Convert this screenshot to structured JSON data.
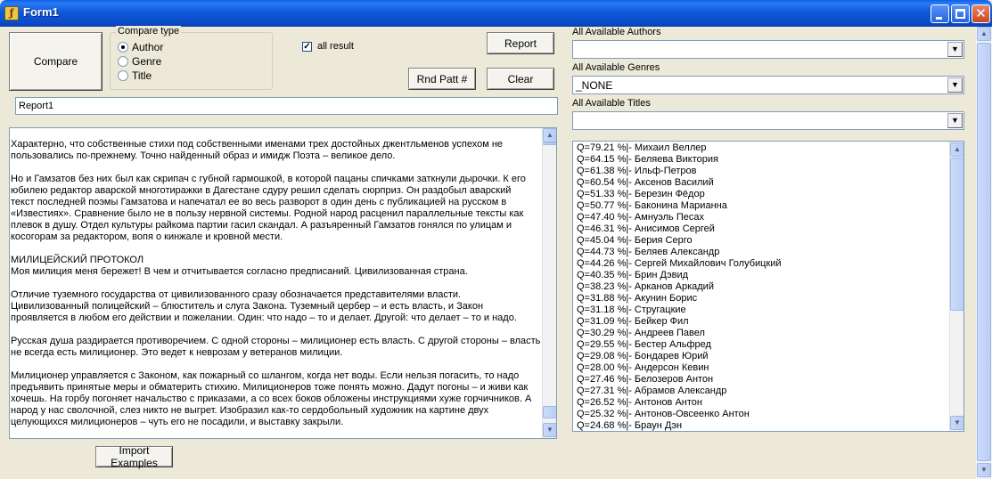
{
  "window": {
    "title": "Form1"
  },
  "buttons": {
    "compare": "Compare",
    "report": "Report",
    "rnd_patt": "Rnd Patt #",
    "clear": "Clear",
    "import_examples": "Import Examples"
  },
  "compare_type": {
    "title": "Compare type",
    "options": [
      "Author",
      "Genre",
      "Title"
    ],
    "selected": "Author"
  },
  "all_result": {
    "label": "all result",
    "checked": true
  },
  "report_field": {
    "value": "Report1"
  },
  "memo_text": "Характерно, что собственные стихи под собственными именами трех достойных джентльменов успехом не\nпользовались по-прежнему. Точно найденный образ и имидж Поэта – великое дело.\n\nНо и Гамзатов без них был как скрипач с губной гармошкой, в которой пацаны спичками заткнули дырочки. К его\nюбилею редактор аварской многотиражки в Дагестане сдуру решил сделать сюрприз. Он раздобыл аварский\nтекст последней поэмы Гамзатова и напечатал ее во весь разворот в один день с публикацией на русском в\n«Известиях». Сравнение было не в пользу нервной системы. Родной народ расценил параллельные тексты как\nплевок в душу. Отдел культуры райкома партии гасил скандал. А разъяренный Гамзатов гонялся по улицам и\nкосогорам за редактором, вопя о кинжале и кровной мести.\n\nМИЛИЦЕЙСКИЙ ПРОТОКОЛ\nМоя милиция меня бережет! В чем и отчитывается согласно предписаний. Цивилизованная страна.\n\nОтличие туземного государства от цивилизованного сразу обозначается представителями власти.\nЦивилизованный полицейский – блюститель и слуга Закона. Туземный цербер – и есть власть, и Закон\nпроявляется в любом его действии и пожелании. Один: что надо – то и делает. Другой: что делает – то и надо.\n\nРусская душа раздирается противоречием. С одной стороны – милиционер есть власть. С другой стороны – власть\nне всегда есть милиционер. Это ведет к неврозам у ветеранов милиции.\n\nМилиционер управляется с Законом, как пожарный со шлангом, когда нет воды. Если нельзя погасить, то надо\nпредъявить принятые меры и обматерить стихию. Милиционеров тоже понять можно. Дадут погоны – и живи как\nхочешь. На горбу погоняет начальство с приказами, а со всех боков обложены инструкциями хуже горчичников. А\nнарод у нас сволочной, слез никто не выгрет. Изобразил как-то сердобольный художник на картине двух\nцелующихся милиционеров – чуть его не посадили, и выставку закрыли.",
  "authors": {
    "label": "All Available Authors",
    "value": ""
  },
  "genres": {
    "label": "All Available Genres",
    "value": "_NONE"
  },
  "titles": {
    "label": "All Available Titles",
    "value": ""
  },
  "results": [
    "Q=79.21 %|- Михаил Веллер",
    "Q=64.15 %|- Беляева Виктория",
    "Q=61.38 %|- Ильф-Петров",
    "Q=60.54 %|- Аксенов Василий",
    "Q=51.33 %|- Березин Фёдор",
    "Q=50.77 %|- Баконина Марианна",
    "Q=47.40 %|- Амнуэль Песах",
    "Q=46.31 %|- Анисимов Сергей",
    "Q=45.04 %|- Берия Серго",
    "Q=44.73 %|- Беляев Александр",
    "Q=44.26 %|- Сергей Михайлович Голубицкий",
    "Q=40.35 %|- Брин Дэвид",
    "Q=38.23 %|- Арканов Аркадий",
    "Q=31.88 %|- Акунин Борис",
    "Q=31.18 %|- Стругацкие",
    "Q=31.09 %|- Бейкер Фил",
    "Q=30.29 %|- Андреев Павел",
    "Q=29.55 %|- Бестер Альфред",
    "Q=29.08 %|- Бондарев Юрий",
    "Q=28.00 %|- Андерсон Кевин",
    "Q=27.46 %|- Белозеров Антон",
    "Q=27.31 %|- Абрамов Александр",
    "Q=26.52 %|- Антонов Антон",
    "Q=25.32 %|- Антонов-Овсеенко Антон",
    "Q=24.68 %|- Браун Дэн"
  ]
}
